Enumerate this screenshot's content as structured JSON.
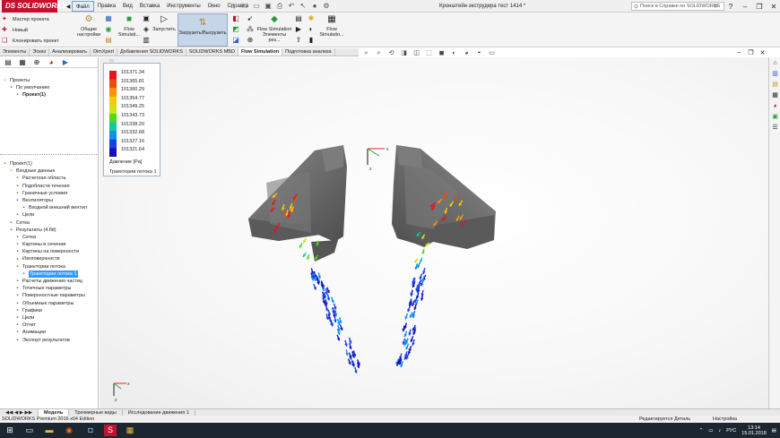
{
  "app": {
    "logo_ds": "DS",
    "logo_text": "SOLIDWORKS",
    "document_title": "Кронштейн экструдера тест 1414 *",
    "help_search_placeholder": "Поиск в Справке по SOLIDWORKS"
  },
  "menu": [
    "Файл",
    "Правка",
    "Вид",
    "Вставка",
    "Инструменты",
    "Окно",
    "Справка"
  ],
  "file_commands": [
    "Мастер проекта",
    "Новый",
    "Клонировать проект"
  ],
  "commands": {
    "general_settings": [
      "Общие",
      "настройки"
    ],
    "flow_sim_1": [
      "Flow",
      "Simulati..."
    ],
    "run": "Запустить",
    "load_unload": "Загрузить/Выгрузить",
    "flow_elements": [
      "Flow Simulation",
      "Элементы рез..."
    ],
    "flow_sim_2": [
      "Flow",
      "Simulatio..."
    ]
  },
  "tabs": [
    "Элементы",
    "Эскиз",
    "Анализировать",
    "DimXpert",
    "Добавления SOLIDWORKS",
    "SOLIDWORKS MBD",
    "Flow Simulation",
    "Подготовка анализа"
  ],
  "active_tab": "Flow Simulation",
  "tree_top": [
    {
      "label": "Проекты",
      "indent": 0,
      "icon": "folder-icon"
    },
    {
      "label": "По умолчанию",
      "indent": 1,
      "icon": "config-icon"
    },
    {
      "label": "Проект(1)",
      "indent": 2,
      "icon": "project-icon",
      "bold": true
    }
  ],
  "tree_bottom": [
    {
      "label": "Проект(1)",
      "indent": 0,
      "icon": "project-icon"
    },
    {
      "label": "Входные данные",
      "indent": 1,
      "icon": "folder-icon"
    },
    {
      "label": "Расчетная область",
      "indent": 2,
      "icon": "domain-icon"
    },
    {
      "label": "Подобласти течения",
      "indent": 2,
      "icon": "fluid-icon"
    },
    {
      "label": "Граничные условия",
      "indent": 2,
      "icon": "boundary-icon"
    },
    {
      "label": "Вентиляторы",
      "indent": 2,
      "icon": "fan-icon"
    },
    {
      "label": "Входной внешний вентил",
      "indent": 3,
      "icon": "fan-icon"
    },
    {
      "label": "Цели",
      "indent": 2,
      "icon": "goal-icon"
    },
    {
      "label": "Сетка",
      "indent": 1,
      "icon": "mesh-icon"
    },
    {
      "label": "Результаты (4.fld)",
      "indent": 1,
      "icon": "results-icon"
    },
    {
      "label": "Сетка",
      "indent": 2,
      "icon": "mesh-icon"
    },
    {
      "label": "Картины в сечении",
      "indent": 2,
      "icon": "cut-plot-icon"
    },
    {
      "label": "Картины на поверхности",
      "indent": 2,
      "icon": "surface-plot-icon"
    },
    {
      "label": "Изоповерхности",
      "indent": 2,
      "icon": "isosurface-icon"
    },
    {
      "label": "Траектории потока",
      "indent": 2,
      "icon": "trajectory-icon"
    },
    {
      "label": "Траектории потока 1",
      "indent": 3,
      "icon": "trajectory-icon",
      "selected": true
    },
    {
      "label": "Расчеты движения частиц",
      "indent": 2,
      "icon": "particle-icon"
    },
    {
      "label": "Точечные параметры",
      "indent": 2,
      "icon": "point-icon"
    },
    {
      "label": "Поверхностные параметры",
      "indent": 2,
      "icon": "surface-param-icon"
    },
    {
      "label": "Объемные параметры",
      "indent": 2,
      "icon": "volume-param-icon"
    },
    {
      "label": "Графики",
      "indent": 2,
      "icon": "graph-icon"
    },
    {
      "label": "Цели",
      "indent": 2,
      "icon": "goal-icon"
    },
    {
      "label": "Отчет",
      "indent": 2,
      "icon": "report-icon"
    },
    {
      "label": "Анимации",
      "indent": 2,
      "icon": "animation-icon"
    },
    {
      "label": "Экспорт результатов",
      "indent": 2,
      "icon": "export-icon"
    }
  ],
  "legend": {
    "values": [
      "101371.34",
      "101365.81",
      "101360.29",
      "101354.77",
      "101349.25",
      "101343.73",
      "101338.20",
      "101332.68",
      "101327.16",
      "101321.64"
    ],
    "unit": "Давление [Pa]",
    "name": "Траектории потока 1",
    "colors": [
      "#e8141b",
      "#f04a12",
      "#f7940a",
      "#f8c80c",
      "#c9e60f",
      "#4fd81e",
      "#10c9a0",
      "#0f8ff0",
      "#1540e6",
      "#1a10b8"
    ]
  },
  "bottom_tabs": [
    "Модель",
    "Трехмерные виды",
    "Исследование движения 1"
  ],
  "status": {
    "left": "SOLIDWORKS Premium 2016 x64 Edition",
    "editing": "Редактируется Деталь",
    "custom": "Настройка"
  },
  "taskbar": {
    "lang": "РУС",
    "time": "13:14",
    "date": "15.01.2018"
  },
  "colors": {
    "brand": "#c8102e",
    "selection": "#3399ff",
    "part": "#6e6e6e"
  }
}
